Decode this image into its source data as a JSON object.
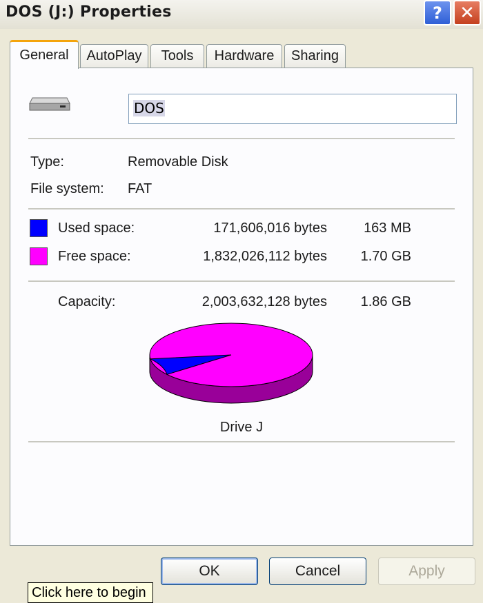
{
  "window": {
    "title": "DOS (J:) Properties"
  },
  "title_buttons": {
    "help": "?",
    "close": "✕"
  },
  "tabs": [
    {
      "label": "General",
      "active": true
    },
    {
      "label": "AutoPlay",
      "active": false
    },
    {
      "label": "Tools",
      "active": false
    },
    {
      "label": "Hardware",
      "active": false
    },
    {
      "label": "Sharing",
      "active": false
    }
  ],
  "drive": {
    "icon": "removable-drive-icon",
    "label_value": "DOS",
    "type_label": "Type:",
    "type_value": "Removable Disk",
    "fs_label": "File system:",
    "fs_value": "FAT"
  },
  "space": {
    "used": {
      "label": "Used space:",
      "bytes": "171,606,016 bytes",
      "size": "163 MB",
      "color": "#0000ff"
    },
    "free": {
      "label": "Free space:",
      "bytes": "1,832,026,112 bytes",
      "size": "1.70 GB",
      "color": "#ff00ff"
    },
    "capacity": {
      "label": "Capacity:",
      "bytes": "2,003,632,128 bytes",
      "size": "1.86 GB"
    }
  },
  "pie": {
    "caption": "Drive J",
    "used_fraction": 0.0856,
    "used_color": "#0000ff",
    "free_color": "#ff00ff",
    "side_color": "#990099"
  },
  "buttons": {
    "ok": "OK",
    "cancel": "Cancel",
    "apply": "Apply"
  },
  "tooltip": {
    "text": "Click here to begin"
  }
}
